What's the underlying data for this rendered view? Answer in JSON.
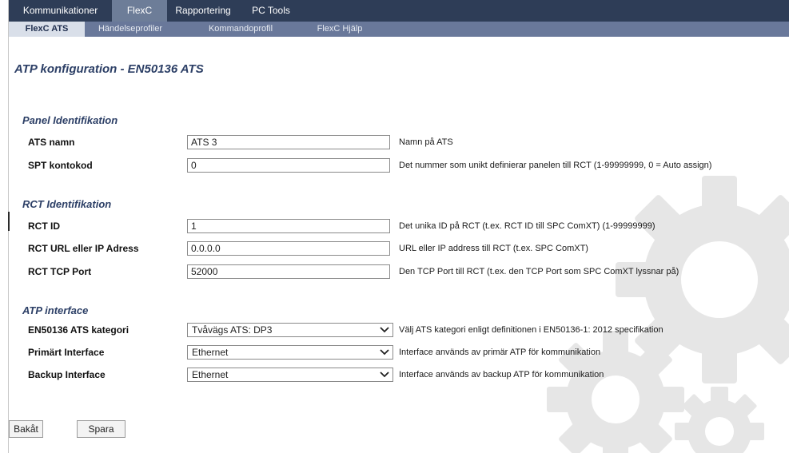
{
  "top_tabs": [
    {
      "label": "Kommunikationer",
      "active": false
    },
    {
      "label": "FlexC",
      "active": true
    },
    {
      "label": "Rapportering",
      "active": false
    },
    {
      "label": "PC Tools",
      "active": false
    }
  ],
  "sub_tabs": [
    {
      "label": "FlexC ATS",
      "active": true
    },
    {
      "label": "Händelseprofiler",
      "active": false
    },
    {
      "label": "Kommandoprofil",
      "active": false
    },
    {
      "label": "FlexC Hjälp",
      "active": false
    }
  ],
  "page_title": "ATP konfiguration - EN50136 ATS",
  "sections": {
    "panel": {
      "title": "Panel Identifikation",
      "fields": [
        {
          "label": "ATS namn",
          "value": "ATS 3",
          "desc": "Namn på ATS"
        },
        {
          "label": "SPT kontokod",
          "value": "0",
          "desc": "Det nummer som unikt definierar panelen till RCT (1-99999999, 0 = Auto assign)"
        }
      ]
    },
    "rct": {
      "title": "RCT Identifikation",
      "fields": [
        {
          "label": "RCT ID",
          "value": "1",
          "desc": "Det unika ID på RCT (t.ex. RCT ID till SPC ComXT) (1-99999999)"
        },
        {
          "label": "RCT URL eller IP Adress",
          "value": "0.0.0.0",
          "desc": "URL eller IP address till RCT (t.ex. SPC ComXT)"
        },
        {
          "label": "RCT TCP Port",
          "value": "52000",
          "desc": "Den TCP Port till RCT (t.ex. den TCP Port som SPC ComXT lyssnar på)"
        }
      ]
    },
    "atp": {
      "title": "ATP interface",
      "fields": [
        {
          "label": "EN50136 ATS kategori",
          "value": "Tvåvägs ATS: DP3",
          "desc": "Välj ATS kategori enligt definitionen i EN50136-1: 2012 specifikation"
        },
        {
          "label": "Primärt Interface",
          "value": "Ethernet",
          "desc": "Interface används av primär ATP för kommunikation"
        },
        {
          "label": "Backup Interface",
          "value": "Ethernet",
          "desc": "Interface används av backup ATP för kommunikation"
        }
      ]
    }
  },
  "buttons": {
    "back": "Bakåt",
    "save": "Spara"
  },
  "icons": {
    "background": "gear-icon",
    "dropdown": "chevron-down-icon"
  },
  "colors": {
    "nav_dark": "#2e3d57",
    "nav_active": "#6d7d98",
    "subnav": "#69789a",
    "subnav_active": "#d9dfe9",
    "heading": "#2c3f66",
    "gear": "#e4e4e4"
  }
}
